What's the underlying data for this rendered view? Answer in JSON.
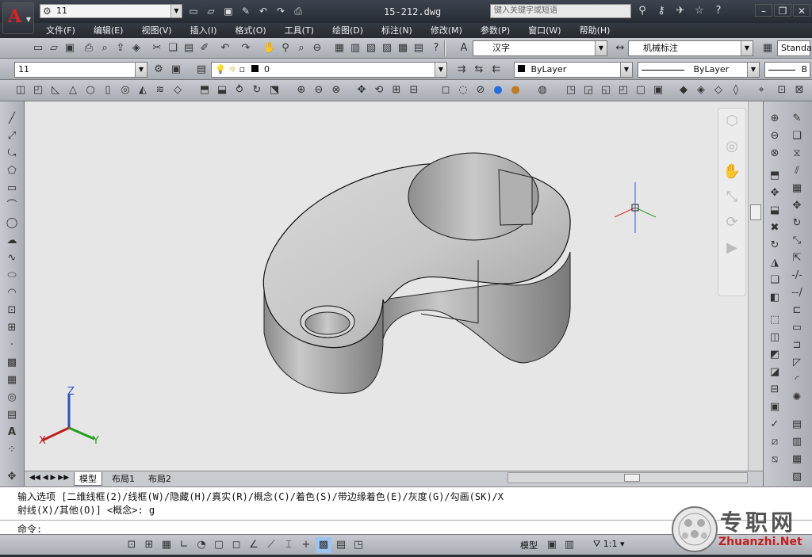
{
  "app": {
    "logo": "A",
    "title": "15-212.dwg"
  },
  "workspace": {
    "value": "11"
  },
  "search": {
    "placeholder": "键入关键字或短语"
  },
  "menu": [
    "文件(F)",
    "编辑(E)",
    "视图(V)",
    "插入(I)",
    "格式(O)",
    "工具(T)",
    "绘图(D)",
    "标注(N)",
    "修改(M)",
    "参数(P)",
    "窗口(W)",
    "帮助(H)"
  ],
  "toolbar2": {
    "text_style": "汉字",
    "dim_style": "机械标注",
    "table_style": "Standa"
  },
  "toolbar3": {
    "layer_state": "11",
    "layer": "0",
    "color": "ByLayer",
    "linetype": "ByLayer",
    "lineweight": "B"
  },
  "tabs": [
    "模型",
    "布局1",
    "布局2"
  ],
  "command": {
    "line1": "输入选项 [二维线框(2)/线框(W)/隐藏(H)/真实(R)/概念(C)/着色(S)/带边缘着色(E)/灰度(G)/勾画(SK)/X",
    "line2": "射线(X)/其他(O)] <概念>: g",
    "prompt": "命令:"
  },
  "status": {
    "space": "模型",
    "scale": "1:1"
  },
  "watermark": {
    "cn": "专职网",
    "en": "Zhuanzhi.Net"
  },
  "ucs": {
    "x": "X",
    "y": "Y",
    "z": "Z"
  }
}
